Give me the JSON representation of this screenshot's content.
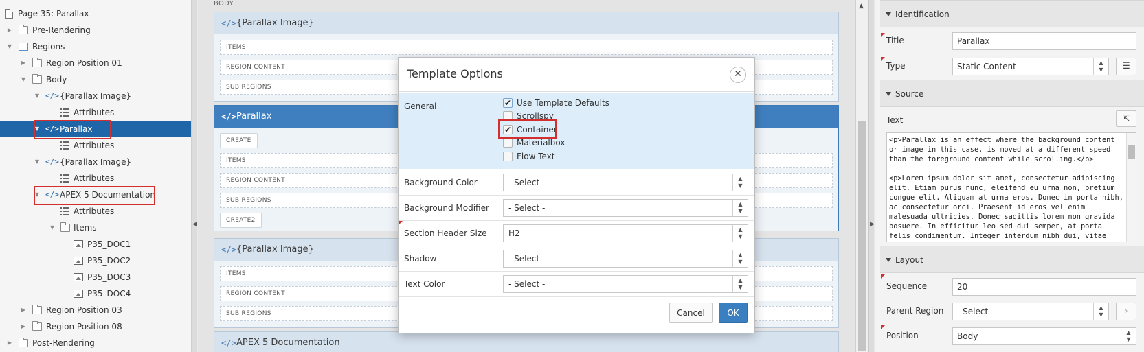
{
  "tree": {
    "page": "Page 35: Parallax",
    "pre_rendering": "Pre-Rendering",
    "regions": "Regions",
    "region_position_01": "Region Position 01",
    "body": "Body",
    "parallax_image_1": "{Parallax Image}",
    "attributes": "Attributes",
    "parallax": "Parallax",
    "parallax_image_2": "{Parallax Image}",
    "apex_doc": "APEX 5 Documentation",
    "items": "Items",
    "doc_items": [
      "P35_DOC1",
      "P35_DOC2",
      "P35_DOC3",
      "P35_DOC4"
    ],
    "region_position_03": "Region Position 03",
    "region_position_08": "Region Position 08",
    "post_rendering": "Post-Rendering"
  },
  "canvas": {
    "body_label": "BODY",
    "region1": {
      "title": "{Parallax Image}",
      "slots": [
        "ITEMS",
        "REGION CONTENT",
        "SUB REGIONS"
      ]
    },
    "region2": {
      "title": "Parallax",
      "create": "CREATE",
      "slots": [
        "ITEMS",
        "REGION CONTENT",
        "SUB REGIONS"
      ],
      "create2": "CREATE2"
    },
    "region3": {
      "title": "{Parallax Image}",
      "slots": [
        "ITEMS",
        "REGION CONTENT",
        "SUB REGIONS"
      ]
    },
    "region4": {
      "title": "APEX 5 Documentation"
    }
  },
  "props": {
    "identification": "Identification",
    "title_label": "Title",
    "title_value": "Parallax",
    "type_label": "Type",
    "type_value": "Static Content",
    "source": "Source",
    "text_label": "Text",
    "text_p1": "<p>Parallax is an effect where the background content or image in this case, is moved at a different speed than the foreground content while scrolling.</p>",
    "text_p2": "<p>Lorem ipsum dolor sit amet, consectetur adipiscing elit. Etiam purus nunc, eleifend eu urna non, pretium congue elit. Aliquam at urna eros. Donec in porta nibh, ac consectetur orci. Praesent id eros vel enim malesuada ultricies. Donec sagittis lorem non gravida posuere. In efficitur leo sed dui semper, at porta felis condimentum. Integer interdum nibh dui, vitae dictum",
    "layout": "Layout",
    "sequence_label": "Sequence",
    "sequence_value": "20",
    "parent_region_label": "Parent Region",
    "parent_region_value": "- Select -",
    "position_label": "Position",
    "position_value": "Body"
  },
  "modal": {
    "title": "Template Options",
    "general_label": "General",
    "options": [
      {
        "label": "Use Template Defaults",
        "checked": true
      },
      {
        "label": "Scrollspy",
        "checked": false
      },
      {
        "label": "Container",
        "checked": true
      },
      {
        "label": "Materialbox",
        "checked": false
      },
      {
        "label": "Flow Text",
        "checked": false
      }
    ],
    "rows": [
      {
        "label": "Background Color",
        "value": "- Select -"
      },
      {
        "label": "Background Modifier",
        "value": "- Select -"
      },
      {
        "label": "Section Header Size",
        "value": "H2"
      },
      {
        "label": "Shadow",
        "value": "- Select -"
      },
      {
        "label": "Text Color",
        "value": "- Select -"
      }
    ],
    "cancel": "Cancel",
    "ok": "OK"
  },
  "icons": {
    "close": "close-icon",
    "chevron": "chevron-icon",
    "code": "code-icon",
    "folder": "folder-icon"
  },
  "colors": {
    "selected_row": "#1f66a8",
    "highlight": "#d32f2f",
    "ok_button": "#3a7fc0"
  }
}
